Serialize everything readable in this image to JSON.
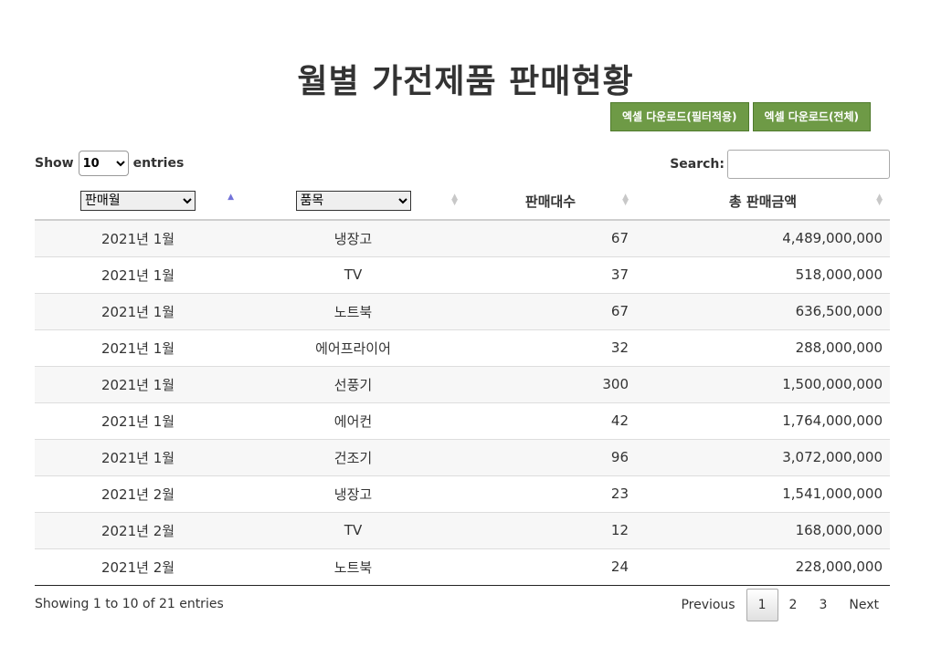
{
  "page": {
    "title": "월별 가전제품 판매현황"
  },
  "export": {
    "filtered_label": "엑셀 다운로드(필터적용)",
    "all_label": "엑셀 다운로드(전체)"
  },
  "length_control": {
    "prefix": "Show",
    "value": "10",
    "suffix": "entries"
  },
  "search": {
    "label": "Search:",
    "value": ""
  },
  "table": {
    "headers": {
      "month_filter": "판매월",
      "item_filter": "품목",
      "quantity": "판매대수",
      "total": "총 판매금액"
    },
    "sort_icons": {
      "ascending": "sort-ascending-icon",
      "unsorted": "sort-both-icon"
    },
    "rows": [
      {
        "month": "2021년 1월",
        "item": "냉장고",
        "quantity": "67",
        "total": "4,489,000,000"
      },
      {
        "month": "2021년 1월",
        "item": "TV",
        "quantity": "37",
        "total": "518,000,000"
      },
      {
        "month": "2021년 1월",
        "item": "노트북",
        "quantity": "67",
        "total": "636,500,000"
      },
      {
        "month": "2021년 1월",
        "item": "에어프라이어",
        "quantity": "32",
        "total": "288,000,000"
      },
      {
        "month": "2021년 1월",
        "item": "선풍기",
        "quantity": "300",
        "total": "1,500,000,000"
      },
      {
        "month": "2021년 1월",
        "item": "에어컨",
        "quantity": "42",
        "total": "1,764,000,000"
      },
      {
        "month": "2021년 1월",
        "item": "건조기",
        "quantity": "96",
        "total": "3,072,000,000"
      },
      {
        "month": "2021년 2월",
        "item": "냉장고",
        "quantity": "23",
        "total": "1,541,000,000"
      },
      {
        "month": "2021년 2월",
        "item": "TV",
        "quantity": "12",
        "total": "168,000,000"
      },
      {
        "month": "2021년 2월",
        "item": "노트북",
        "quantity": "24",
        "total": "228,000,000"
      }
    ]
  },
  "info": "Showing 1 to 10 of 21 entries",
  "pagination": {
    "previous": "Previous",
    "pages": [
      "1",
      "2",
      "3"
    ],
    "current": "1",
    "next": "Next"
  },
  "colors": {
    "export_button": "#6e9a46",
    "sort_active": "#7373d9",
    "stripe": "#f7f7f7"
  }
}
